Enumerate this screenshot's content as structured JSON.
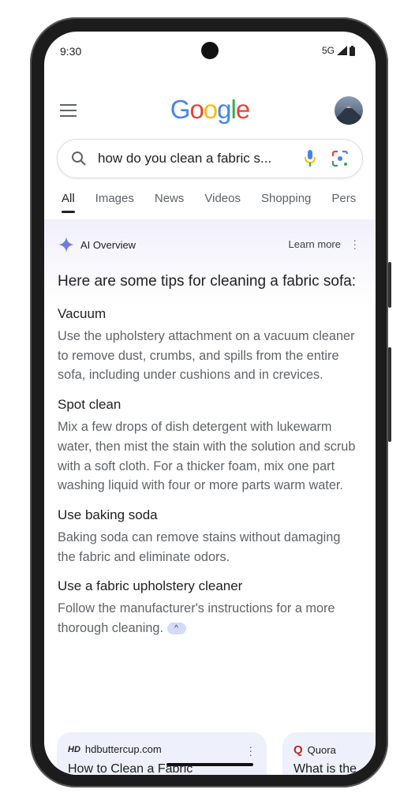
{
  "status_bar": {
    "time": "9:30",
    "network": "5G"
  },
  "header": {
    "logo": "Google",
    "menu_icon": "hamburger-menu-icon",
    "avatar_icon": "mountain-avatar"
  },
  "search": {
    "query": "how do you clean a fabric s...",
    "voice_icon": "microphone-icon",
    "lens_icon": "google-lens-icon"
  },
  "tabs": [
    {
      "label": "All",
      "active": true
    },
    {
      "label": "Images"
    },
    {
      "label": "News"
    },
    {
      "label": "Videos"
    },
    {
      "label": "Shopping"
    },
    {
      "label": "Pers"
    }
  ],
  "ai_overview": {
    "title": "AI Overview",
    "learn_more": "Learn more",
    "headline": "Here are some tips for cleaning a fabric sofa:",
    "sections": [
      {
        "title": "Vacuum",
        "body": "Use the upholstery attachment on a vacuum cleaner to remove dust, crumbs, and spills from the entire sofa, including under cushions and in crevices."
      },
      {
        "title": "Spot clean",
        "body": "Mix a few drops of dish detergent with lukewarm water, then mist the stain with the solution and scrub with a soft cloth. For a thicker foam, mix one part washing liquid with four or more parts warm water."
      },
      {
        "title": "Use baking soda",
        "body": "Baking soda can remove stains without damaging the fabric and eliminate odors."
      },
      {
        "title": "Use a fabric upholstery cleaner",
        "body": "Follow the manufacturer's instructions for a more thorough cleaning."
      }
    ]
  },
  "source_cards": [
    {
      "logo": "HD",
      "source": "hdbuttercup.com",
      "title": "How to Clean a Fabric"
    },
    {
      "logo": "Q",
      "source": "Quora",
      "title": "What is the"
    }
  ],
  "colors": {
    "google_blue": "#4285f4",
    "google_red": "#ea4335",
    "google_yellow": "#fbbc05",
    "google_green": "#34a853",
    "ai_band": "#f1f0fb",
    "card_bg": "#eef0fb"
  }
}
